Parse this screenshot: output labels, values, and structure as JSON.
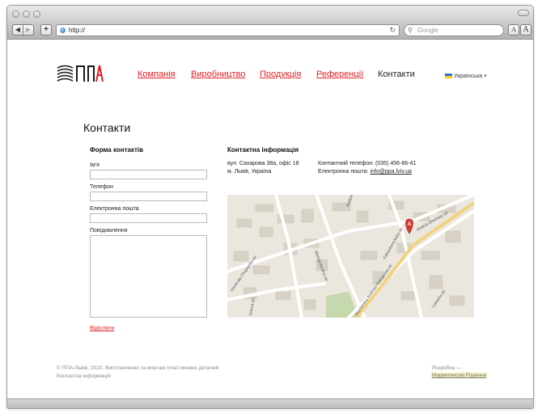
{
  "browser": {
    "url": "http://",
    "search_placeholder": "Google",
    "back_label": "◀",
    "forward_label": "▶",
    "add_label": "+",
    "reload_label": "↻",
    "font_small_label": "A",
    "font_large_label": "A"
  },
  "site": {
    "logo_text": "ППА",
    "nav": [
      {
        "label": "Компанія"
      },
      {
        "label": "Виробництво"
      },
      {
        "label": "Продукція"
      },
      {
        "label": "Референції"
      },
      {
        "label": "Контакти"
      }
    ],
    "language": "Українська",
    "colors": {
      "accent": "#e31e24",
      "text": "#222222"
    }
  },
  "page": {
    "title": "Контакти",
    "form": {
      "heading": "Форма контактів",
      "fields": [
        {
          "label": "Ім'я"
        },
        {
          "label": "Телефон"
        },
        {
          "label": "Електронна пошта"
        },
        {
          "label": "Повідомлення"
        }
      ],
      "submit": "Відіслати"
    },
    "contact": {
      "heading": "Контактна інформація",
      "address_line1": "вул. Сахарова 38а, офіс 18",
      "address_line2": "м. Львів, Україна",
      "phone_label": "Контактний телефон:",
      "phone": "(035) 456-86-41",
      "email_label": "Електронна пошта:",
      "email": "info@ppa.lviv.ua"
    },
    "map": {
      "marker": "A",
      "streets": [
        "Kotlyarevs'koho str",
        "Metropolychna str",
        "Generala Chuprynky str",
        "Kalnyshevs'koho str",
        "Akademika Andreya Sakharova str",
        "Lukasha str",
        "Andriia Sherbaty str",
        "Zelenа str"
      ]
    }
  },
  "footer": {
    "copyright": "© ППА-Львів, 2010. Виготовлення та монтаж пластикових деталей",
    "contact_link": "Контактна інформація",
    "dev_label": "Розробка —",
    "dev_link": "Маркетингові Рішення"
  }
}
